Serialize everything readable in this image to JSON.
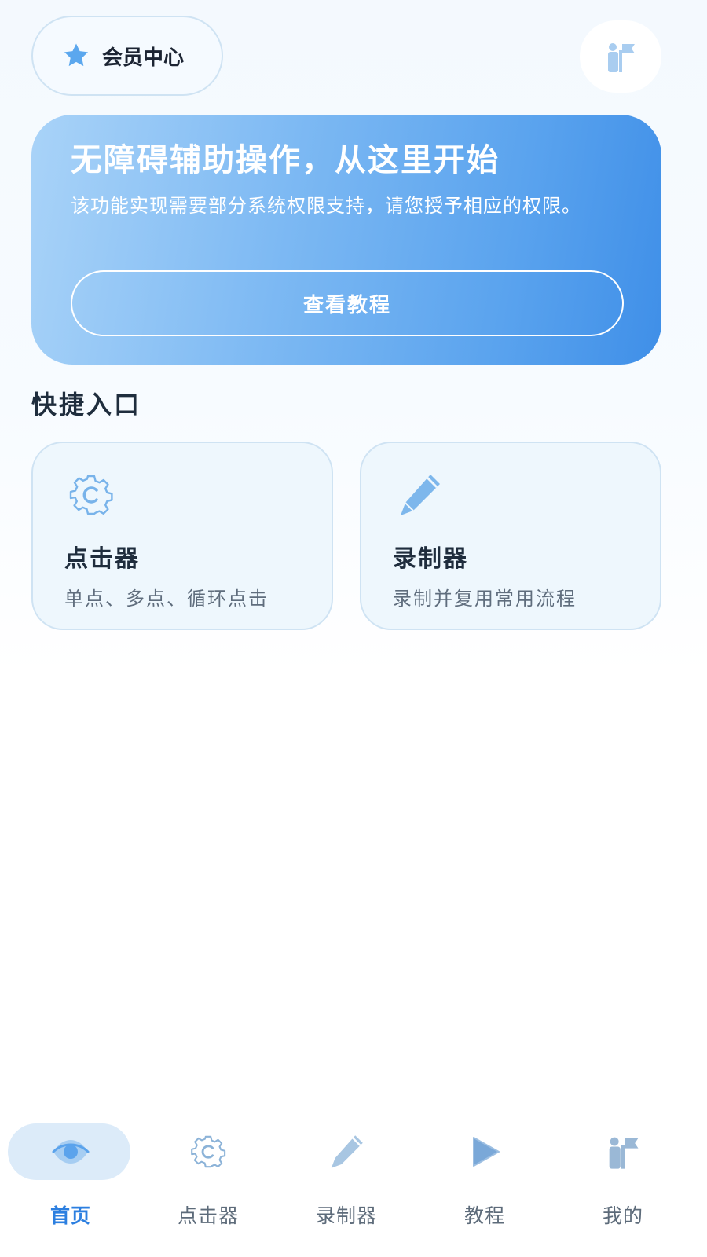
{
  "header": {
    "member_label": "会员中心",
    "member_icon": "star-icon",
    "profile_icon": "person-flag-icon"
  },
  "banner": {
    "title": "无障碍辅助操作，从这里开始",
    "description": "该功能实现需要部分系统权限支持，请您授予相应的权限。",
    "button_label": "查看教程"
  },
  "quick_entry": {
    "section_title": "快捷入口",
    "cards": [
      {
        "title": "点击器",
        "description": "单点、多点、循环点击",
        "icon": "gear-c-icon"
      },
      {
        "title": "录制器",
        "description": "录制并复用常用流程",
        "icon": "pencil-icon"
      }
    ]
  },
  "tabbar": {
    "items": [
      {
        "label": "首页",
        "icon": "eye-icon",
        "active": true
      },
      {
        "label": "点击器",
        "icon": "gear-c-icon",
        "active": false
      },
      {
        "label": "录制器",
        "icon": "pencil-icon",
        "active": false
      },
      {
        "label": "教程",
        "icon": "play-icon",
        "active": false
      },
      {
        "label": "我的",
        "icon": "person-flag-icon",
        "active": false
      }
    ]
  },
  "colors": {
    "accent": "#2c7fe0",
    "banner_start": "#a9d3f8",
    "banner_end": "#3f8fe8",
    "card_bg": "#eef7fd",
    "icon_blue": "#8dbbe6"
  }
}
